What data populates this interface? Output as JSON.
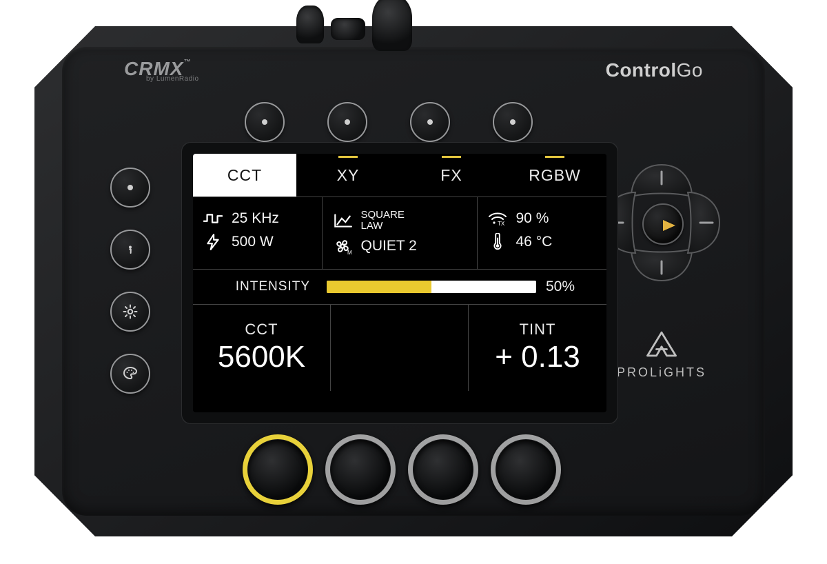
{
  "header": {
    "crmx_brand": "CRMX",
    "crmx_sub": "by LumenRadio",
    "product_a": "Control",
    "product_b": "Go"
  },
  "tabs": {
    "cct": "CCT",
    "xy": "XY",
    "fx": "FX",
    "rgbw": "RGBW"
  },
  "status": {
    "pwm_freq": "25 KHz",
    "power": "500 W",
    "curve": "SQUARE LAW",
    "fan_mode": "QUIET 2",
    "wifi_pct": "90 %",
    "wifi_tx": "TX",
    "temp": "46 °C"
  },
  "intensity": {
    "label": "INTENSITY",
    "percent_text": "50%",
    "percent": 50
  },
  "params": {
    "cct_label": "CCT",
    "cct_value": "5600K",
    "tint_label": "TINT",
    "tint_value": "+ 0.13"
  },
  "brand": {
    "name": "PROLiGHTS"
  }
}
